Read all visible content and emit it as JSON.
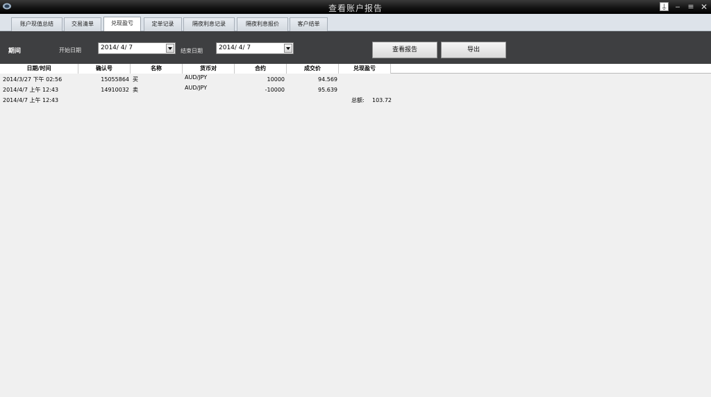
{
  "window": {
    "title": "查看账户报告",
    "controls": {
      "pin": "⍊",
      "minimize": "‒",
      "maximize": "≡",
      "close": "✕"
    }
  },
  "tabs": [
    {
      "label": "账户现值总结",
      "active": false
    },
    {
      "label": "交易清单",
      "active": false
    },
    {
      "label": "兑现盈亏",
      "active": true
    },
    {
      "label": "定单记录",
      "active": false
    },
    {
      "label": "隔夜利息记录",
      "active": false
    },
    {
      "label": "隔夜利息报价",
      "active": false
    },
    {
      "label": "客户结单",
      "active": false
    }
  ],
  "filter": {
    "period_label": "期间",
    "start_label": "开始日期",
    "start_value": "2014/ 4/ 7",
    "end_label": "结束日期",
    "end_value": "2014/ 4/ 7",
    "view_report_button": "查看报告",
    "export_button": "导出"
  },
  "table": {
    "columns": [
      "日期/时间",
      "确认号",
      "名称",
      "货币对",
      "合约",
      "成交价",
      "兑现盈亏"
    ],
    "rows": [
      {
        "datetime": "2014/3/27 下午 02:56",
        "confirm": "15055864",
        "name": "买",
        "pair": "AUD/JPY",
        "contract": "10000",
        "price": "94.569",
        "pnl": ""
      },
      {
        "datetime": "2014/4/7 上午 12:43",
        "confirm": "14910032",
        "name": "卖",
        "pair": "AUD/JPY",
        "contract": "-10000",
        "price": "95.639",
        "pnl": ""
      },
      {
        "datetime": "2014/4/7 上午 12:43",
        "confirm": "",
        "name": "",
        "pair": "",
        "contract": "",
        "price": "",
        "pnl_label": "总额:",
        "pnl": "103.72"
      }
    ]
  },
  "colors": {
    "titlebar": "#000000",
    "panel": "#3e3f41",
    "tabbar": "#dde3ea"
  }
}
